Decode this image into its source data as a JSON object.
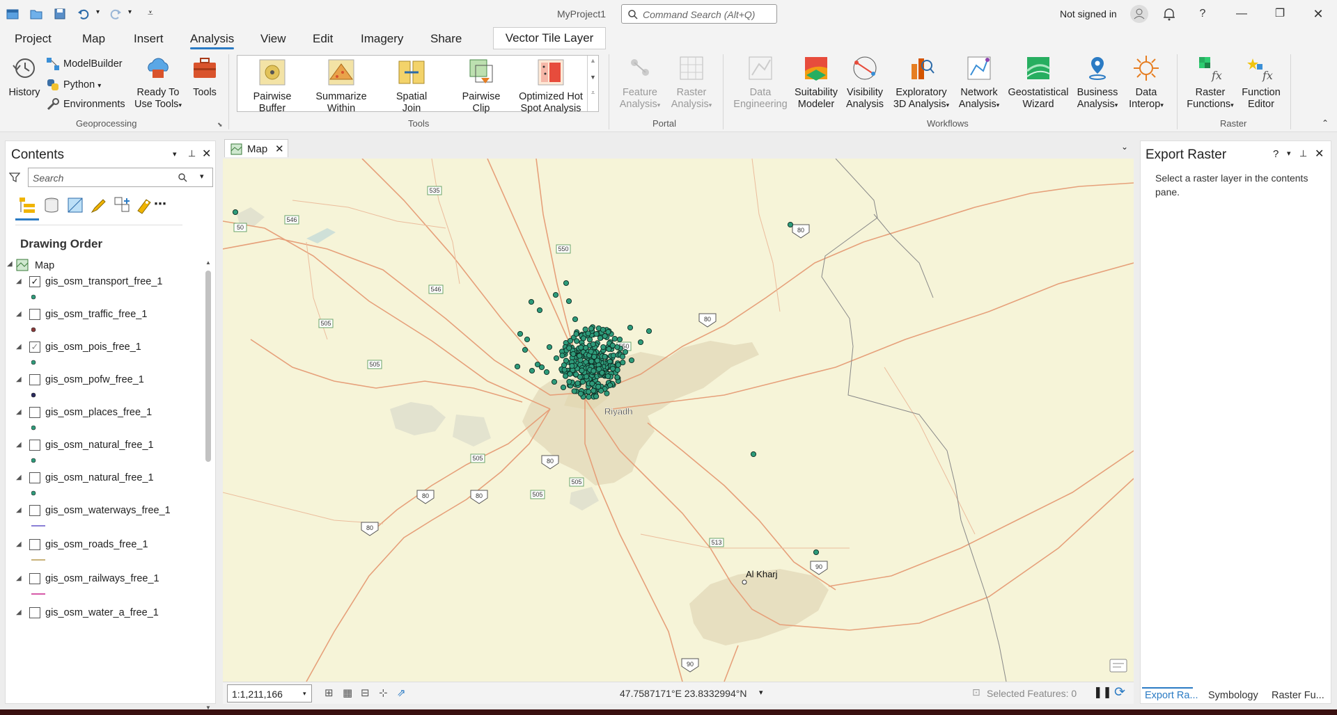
{
  "window": {
    "title": "MyProject1",
    "command_search_placeholder": "Command Search (Alt+Q)",
    "signed_in_label": "Not signed in",
    "help_glyph": "?"
  },
  "ribbon_tabs": [
    "Project",
    "Map",
    "Insert",
    "Analysis",
    "View",
    "Edit",
    "Imagery",
    "Share"
  ],
  "active_tab": "Analysis",
  "contextual_tab": "Vector Tile Layer",
  "ribbon": {
    "geoprocessing": {
      "label": "Geoprocessing",
      "history": "History",
      "modelbuilder": "ModelBuilder",
      "python": "Python",
      "environments": "Environments",
      "ready_to_use_1": "Ready To",
      "ready_to_use_2": "Use Tools",
      "tools": "Tools"
    },
    "tools": {
      "label": "Tools",
      "items": [
        {
          "l1": "Pairwise",
          "l2": "Buffer"
        },
        {
          "l1": "Summarize",
          "l2": "Within"
        },
        {
          "l1": "Spatial",
          "l2": "Join"
        },
        {
          "l1": "Pairwise",
          "l2": "Clip"
        },
        {
          "l1": "Optimized Hot",
          "l2": "Spot Analysis"
        }
      ]
    },
    "portal": {
      "label": "Portal",
      "feature_1": "Feature",
      "feature_2": "Analysis",
      "raster_1": "Raster",
      "raster_2": "Analysis"
    },
    "workflows": {
      "label": "Workflows",
      "items": [
        {
          "l1": "Data",
          "l2": "Engineering",
          "disabled": true
        },
        {
          "l1": "Suitability",
          "l2": "Modeler"
        },
        {
          "l1": "Visibility",
          "l2": "Analysis"
        },
        {
          "l1": "Exploratory",
          "l2": "3D Analysis"
        },
        {
          "l1": "Network",
          "l2": "Analysis"
        },
        {
          "l1": "Geostatistical",
          "l2": "Wizard"
        },
        {
          "l1": "Business",
          "l2": "Analysis"
        },
        {
          "l1": "Data",
          "l2": "Interop"
        }
      ]
    },
    "raster": {
      "label": "Raster",
      "functions_1": "Raster",
      "functions_2": "Functions",
      "editor_1": "Function",
      "editor_2": "Editor"
    }
  },
  "contents": {
    "title": "Contents",
    "search_placeholder": "Search",
    "drawing_order": "Drawing Order",
    "map_node": "Map",
    "layers": [
      {
        "name": "gis_osm_transport_free_1",
        "checked": true,
        "symbol": "point",
        "color": "#2e9b7a"
      },
      {
        "name": "gis_osm_traffic_free_1",
        "checked": false,
        "symbol": "point",
        "color": "#8a3a3a"
      },
      {
        "name": "gis_osm_pois_free_1",
        "checked": true,
        "grey_check": true,
        "symbol": "point",
        "color": "#2e9b7a"
      },
      {
        "name": "gis_osm_pofw_free_1",
        "checked": false,
        "symbol": "point",
        "color": "#2a2a5e"
      },
      {
        "name": "gis_osm_places_free_1",
        "checked": false,
        "symbol": "point",
        "color": "#2e9b7a"
      },
      {
        "name": "gis_osm_natural_free_1",
        "checked": false,
        "symbol": "point",
        "color": "#2e9b7a"
      },
      {
        "name": "gis_osm_natural_free_1",
        "checked": false,
        "symbol": "point",
        "color": "#2e9b7a"
      },
      {
        "name": "gis_osm_waterways_free_1",
        "checked": false,
        "symbol": "line",
        "color": "#8a7fd6"
      },
      {
        "name": "gis_osm_roads_free_1",
        "checked": false,
        "symbol": "line",
        "color": "#c9b27a"
      },
      {
        "name": "gis_osm_railways_free_1",
        "checked": false,
        "symbol": "line",
        "color": "#d65aa8"
      },
      {
        "name": "gis_osm_water_a_free_1",
        "checked": false,
        "symbol": "none",
        "color": "#888888"
      }
    ]
  },
  "map": {
    "tab_label": "Map",
    "labels": {
      "riyadh": "Riyadh",
      "alkharj": "Al Kharj"
    },
    "shields": [
      "535",
      "546",
      "50",
      "550",
      "546",
      "505",
      "505",
      "550",
      "80",
      "80",
      "505",
      "505",
      "80",
      "80",
      "80",
      "80",
      "505",
      "513",
      "90",
      "90"
    ],
    "scale": "1:1,211,166",
    "coordinates": "47.7587171°E 23.8332994°N",
    "selected_features": "Selected Features: 0"
  },
  "export_raster": {
    "title": "Export Raster",
    "message": "Select a raster layer in the contents pane."
  },
  "bottom_tabs": [
    "Export Ra...",
    "Symbology",
    "Raster Fu..."
  ],
  "colors": {
    "accent": "#2b7bc4",
    "map_background": "#f6f4d8",
    "urban": "#e7dfc0",
    "road": "#e6a07a",
    "poi_fill": "#2e9b7a"
  }
}
